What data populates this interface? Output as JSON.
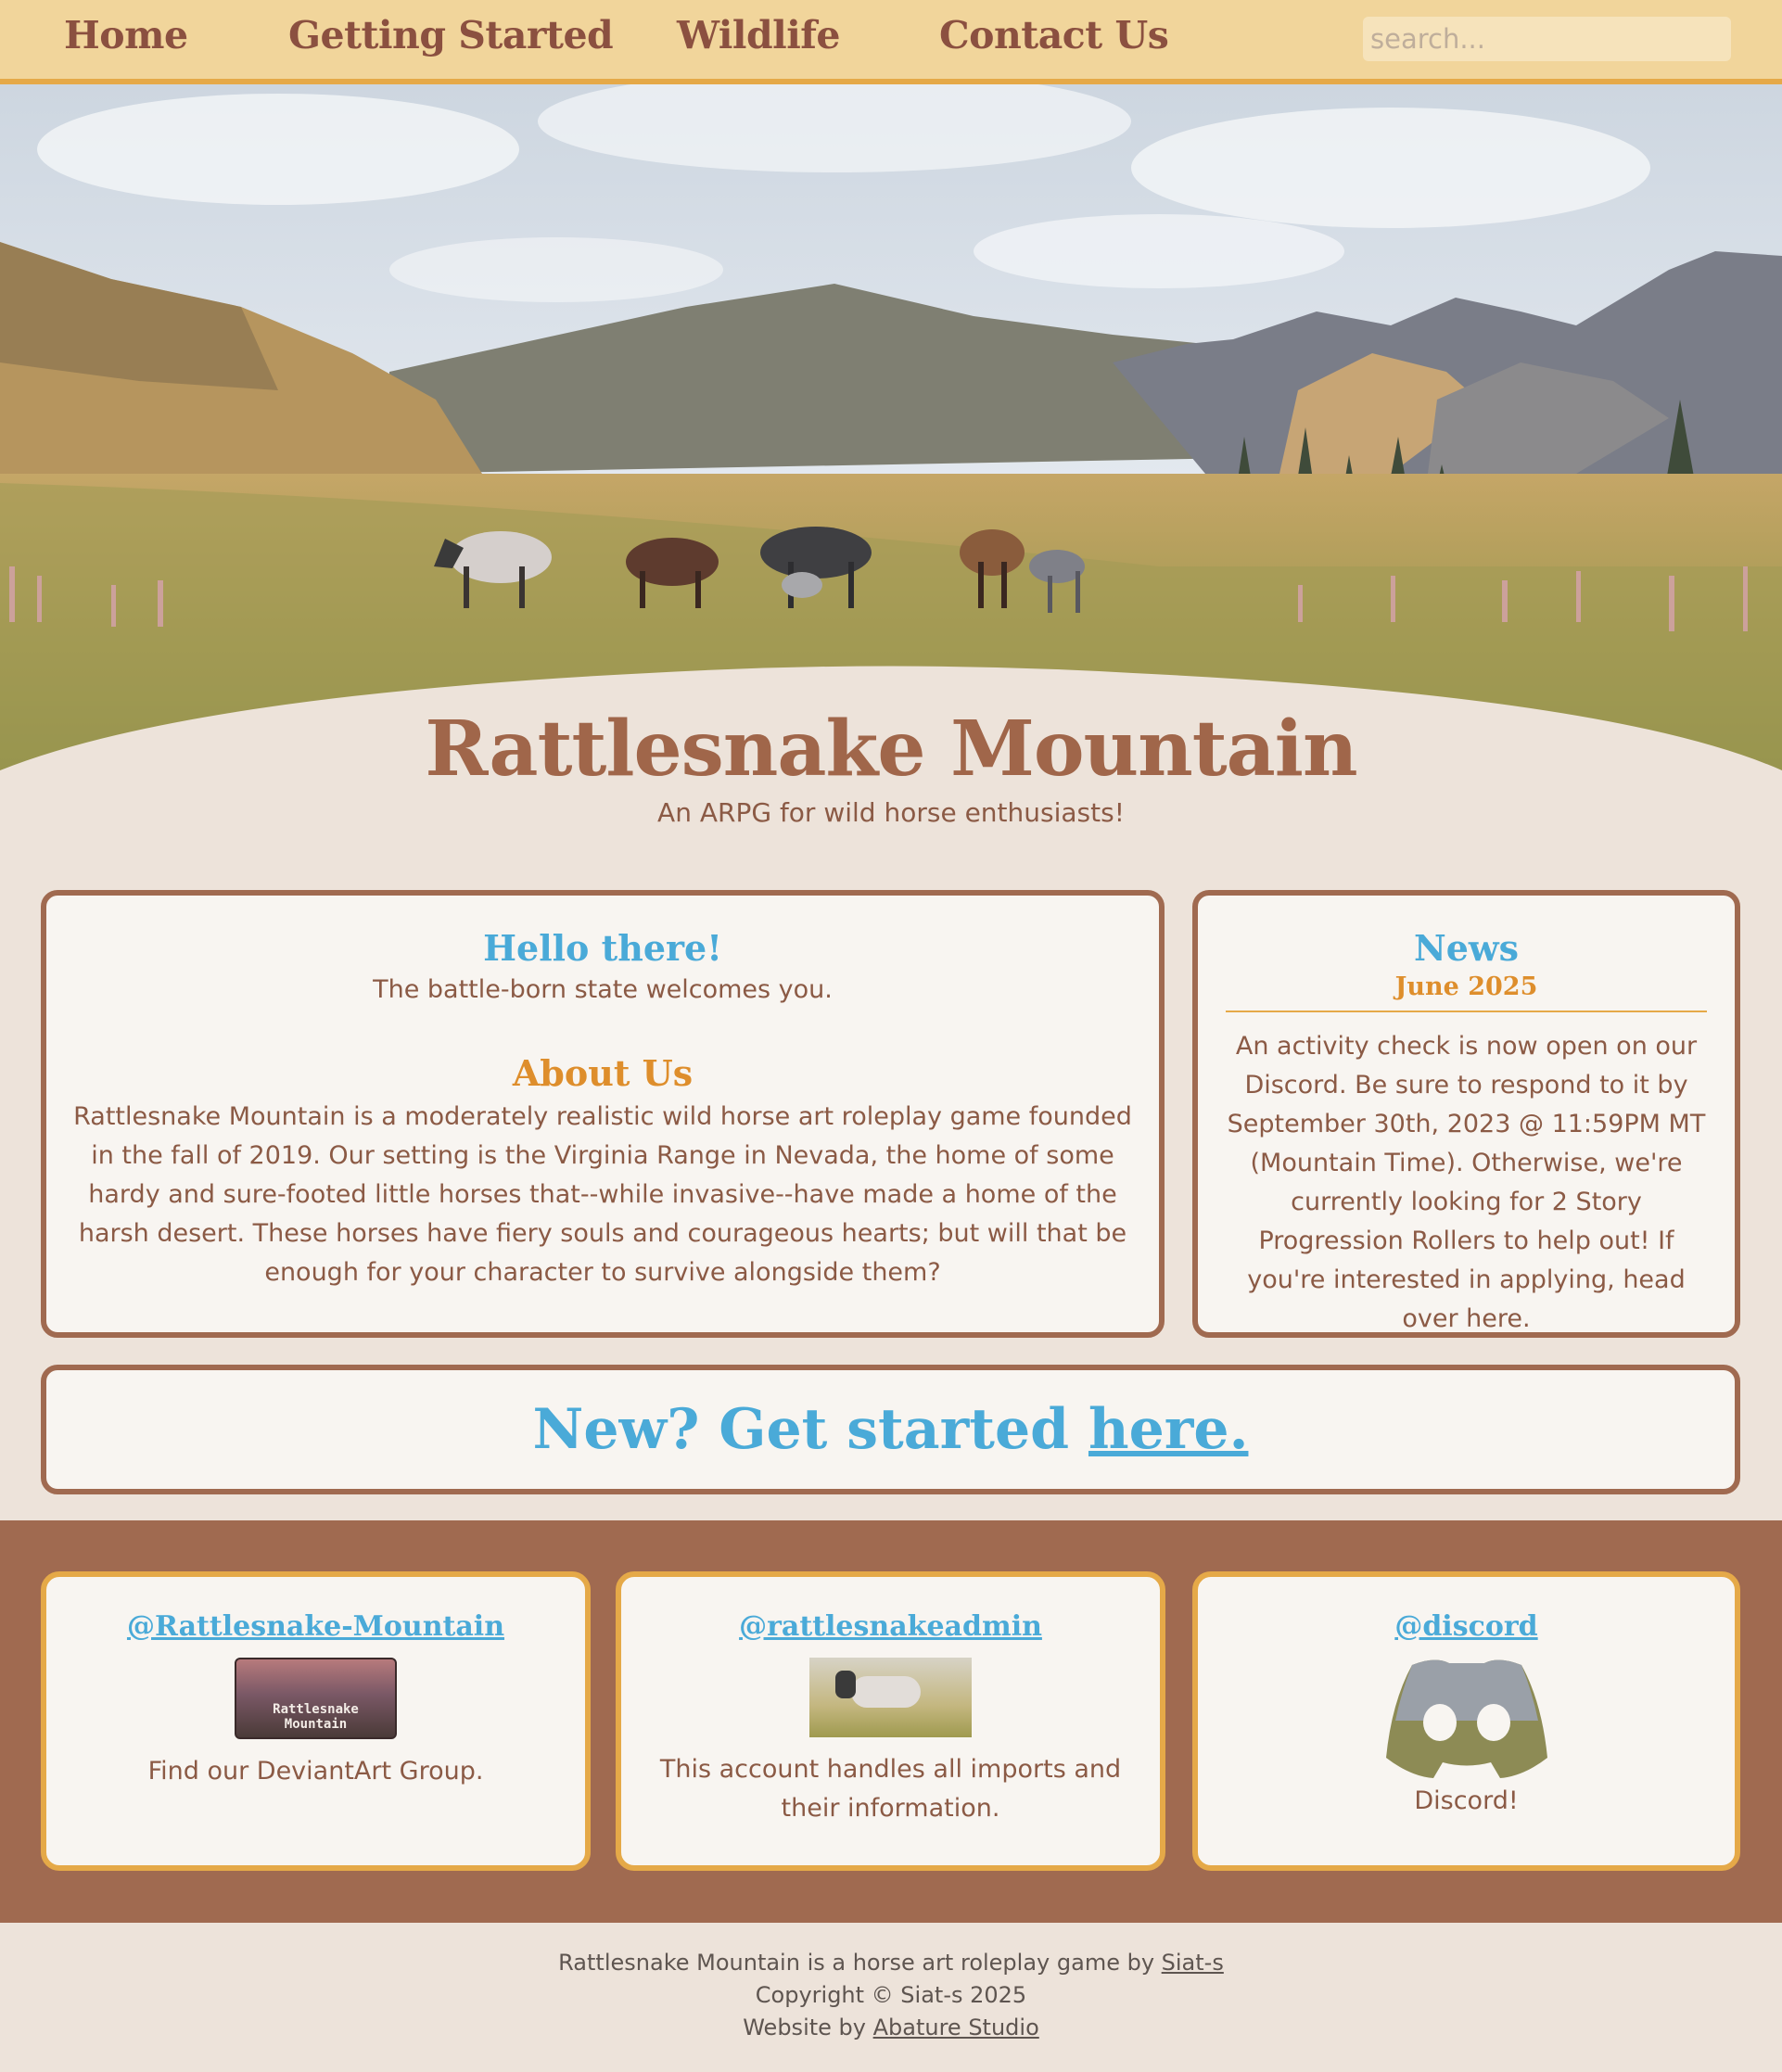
{
  "nav": {
    "items": [
      {
        "label": "Home"
      },
      {
        "label": "Getting Started"
      },
      {
        "label": "Wildlife"
      },
      {
        "label": "Contact Us"
      }
    ],
    "search_placeholder": "search..."
  },
  "hero": {
    "title": "Rattlesnake Mountain",
    "subtitle": "An ARPG for wild horse enthusiasts!"
  },
  "welcome": {
    "heading": "Hello there!",
    "text": "The battle-born state welcomes you.",
    "about_heading": "About Us",
    "about_text": "Rattlesnake Mountain is a moderately realistic wild horse art roleplay game founded in the fall of 2019. Our setting is the Virginia Range in Nevada, the home of some hardy and sure-footed little horses that--while invasive--have made a home of the harsh desert. These horses have fiery souls and courageous hearts; but will that be enough for your character to survive alongside them?"
  },
  "news": {
    "heading": "News",
    "date": "June 2025",
    "text": "An activity check is now open on our Discord. Be sure to respond to it by September 30th, 2023 @ 11:59PM MT (Mountain Time). Otherwise, we're currently looking for 2 Story Progression Rollers to help out! If you're interested in applying, head over here."
  },
  "cta": {
    "prefix": "New? Get started ",
    "link": "here."
  },
  "socials": [
    {
      "handle": "@Rattlesnake-Mountain",
      "thumb_text_1": "Rattlesnake",
      "thumb_text_2": "Mountain",
      "text": "Find our DeviantArt Group."
    },
    {
      "handle": "@rattlesnakeadmin",
      "text": "This account handles all imports and their information."
    },
    {
      "handle": "@discord",
      "text": "Discord!"
    }
  ],
  "footer": {
    "line1_prefix": "Rattlesnake Mountain is a horse art roleplay game by ",
    "line1_link": "Siat-s",
    "line2": "Copyright © Siat-s 2025",
    "line3_prefix": "Website by ",
    "line3_link": "Abature Studio"
  },
  "colors": {
    "nav_bg": "#f1d59b",
    "nav_border": "#e5a948",
    "page_bg": "#ede3da",
    "brown": "#a06a50",
    "heading_blue": "#4aaad8",
    "heading_orange": "#de8e2c",
    "card_bg": "#f8f5f1"
  }
}
